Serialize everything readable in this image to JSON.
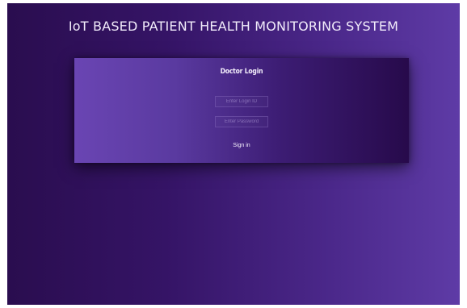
{
  "page": {
    "title": "IoT BASED PATIENT HEALTH MONITORING SYSTEM"
  },
  "login_card": {
    "heading": "Doctor Login",
    "login_id_placeholder": "Enter Login ID",
    "password_placeholder": "Enter Password",
    "signin_label": "Sign in"
  },
  "colors": {
    "background_dark": "#2a0d4f",
    "background_light": "#5e3ba6",
    "card_left": "#6a45b3",
    "card_right": "#270a4b",
    "text": "#f2ecfb"
  }
}
